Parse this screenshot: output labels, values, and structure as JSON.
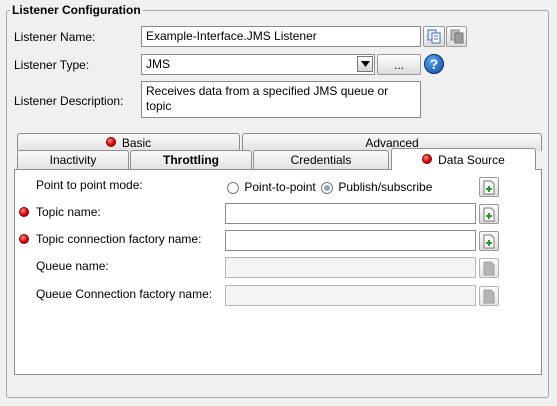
{
  "group": {
    "title": "Listener Configuration"
  },
  "form": {
    "name_label": "Listener Name:",
    "name_value": "Example-Interface.JMS Listener",
    "type_label": "Listener Type:",
    "type_value": "JMS",
    "browse_label": "...",
    "help_label": "?",
    "desc_label": "Listener Description:",
    "desc_value": "Receives data from a specified JMS queue or topic"
  },
  "tabs": {
    "basic": "Basic",
    "advanced": "Advanced",
    "inactivity": "Inactivity",
    "throttling": "Throttling",
    "credentials": "Credentials",
    "data_source": "Data Source"
  },
  "data_source": {
    "mode_label": "Point to point mode:",
    "mode_options": [
      "Point-to-point",
      "Publish/subscribe"
    ],
    "mode_selected": "Publish/subscribe",
    "topic_name_label": "Topic name:",
    "topic_name_value": "",
    "topic_factory_label": "Topic connection factory name:",
    "topic_factory_value": "",
    "queue_name_label": "Queue name:",
    "queue_name_value": "",
    "queue_factory_label": "Queue Connection factory name:",
    "queue_factory_value": ""
  },
  "icons": {
    "required": "required-dot-icon",
    "copy": "copy-icon",
    "paste": "paste-icon",
    "new_document": "new-document-icon"
  },
  "colors": {
    "required": "#d20000",
    "help": "#0b4fa8"
  }
}
